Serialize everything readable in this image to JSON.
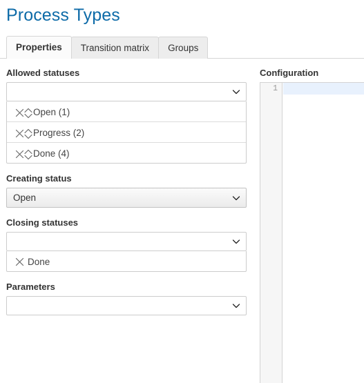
{
  "page": {
    "title": "Process Types",
    "title_color": "#0e6ba8"
  },
  "tabs": [
    {
      "label": "Properties",
      "active": true
    },
    {
      "label": "Transition matrix",
      "active": false
    },
    {
      "label": "Groups",
      "active": false
    }
  ],
  "form": {
    "allowed_statuses": {
      "label": "Allowed statuses",
      "select_value": "",
      "placeholder": "",
      "items": [
        {
          "label": "Open (1)",
          "sortable": true
        },
        {
          "label": "Progress (2)",
          "sortable": true
        },
        {
          "label": "Done (4)",
          "sortable": true
        }
      ]
    },
    "creating_status": {
      "label": "Creating status",
      "select_value": "Open"
    },
    "closing_statuses": {
      "label": "Closing statuses",
      "select_value": "",
      "placeholder": "",
      "items": [
        {
          "label": "Done",
          "sortable": false
        }
      ]
    },
    "parameters": {
      "label": "Parameters",
      "select_value": "",
      "placeholder": ""
    }
  },
  "configuration": {
    "label": "Configuration",
    "active_line_color": "#e8f1fd",
    "lines": [
      {
        "number": "1",
        "text": "",
        "active": true
      }
    ]
  },
  "icons": {
    "remove": "close-x-icon",
    "sort": "sort-updown-icon",
    "dropdown": "chevron-down-icon"
  }
}
